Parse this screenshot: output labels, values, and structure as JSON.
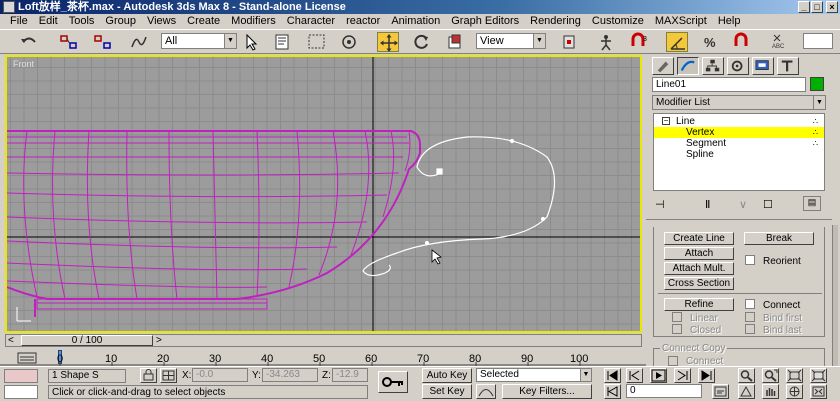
{
  "window": {
    "title": "Loft放样_茶杯.max - Autodesk 3ds Max 8 - Stand-alone License",
    "minimize": "_",
    "maximize": "□",
    "close": "×"
  },
  "menu": [
    "File",
    "Edit",
    "Tools",
    "Group",
    "Views",
    "Create",
    "Modifiers",
    "Character",
    "reactor",
    "Animation",
    "Graph Editors",
    "Rendering",
    "Customize",
    "MAXScript",
    "Help"
  ],
  "toolbar": {
    "selection_filter": "All",
    "reference_coord": "View"
  },
  "viewport": {
    "label": "Front",
    "colors": {
      "cup_wire": "#c020c0",
      "handle_spline": "#ffffff",
      "border": "#e8e800"
    }
  },
  "command_panel": {
    "object_name": "Line01",
    "object_color": "#00b000",
    "modifier_list": "Modifier List",
    "stack": [
      {
        "label": "Line",
        "selected": false
      },
      {
        "label": "Vertex",
        "selected": true
      },
      {
        "label": "Segment",
        "selected": false
      },
      {
        "label": "Spline",
        "selected": false
      }
    ],
    "buttons": {
      "create_line": "Create Line",
      "break": "Break",
      "attach": "Attach",
      "reorient": "Reorient",
      "attach_mult": "Attach Mult.",
      "cross_section": "Cross Section",
      "refine": "Refine",
      "connect": "Connect",
      "linear": "Linear",
      "bind_first": "Bind first",
      "closed": "Closed",
      "bind_last": "Bind last",
      "connect_copy_group": "Connect Copy",
      "connect_copy": "Connect"
    }
  },
  "time_slider": {
    "label": "0 / 100",
    "prev": "<",
    "next": ">"
  },
  "trackbar": {
    "ticks": [
      "0",
      "10",
      "20",
      "30",
      "40",
      "50",
      "60",
      "70",
      "80",
      "90",
      "100"
    ]
  },
  "status": {
    "selection_count": "1 Shape S",
    "prompt": "Click or click-and-drag to select objects",
    "x_label": "X:",
    "x_value": "-0.0",
    "y_label": "Y:",
    "y_value": "-34.263",
    "z_label": "Z:",
    "z_value": "-12.9",
    "auto_key": "Auto Key",
    "set_key": "Set Key",
    "key_mode": "Selected",
    "key_filters": "Key Filters...",
    "current_frame": "0"
  }
}
